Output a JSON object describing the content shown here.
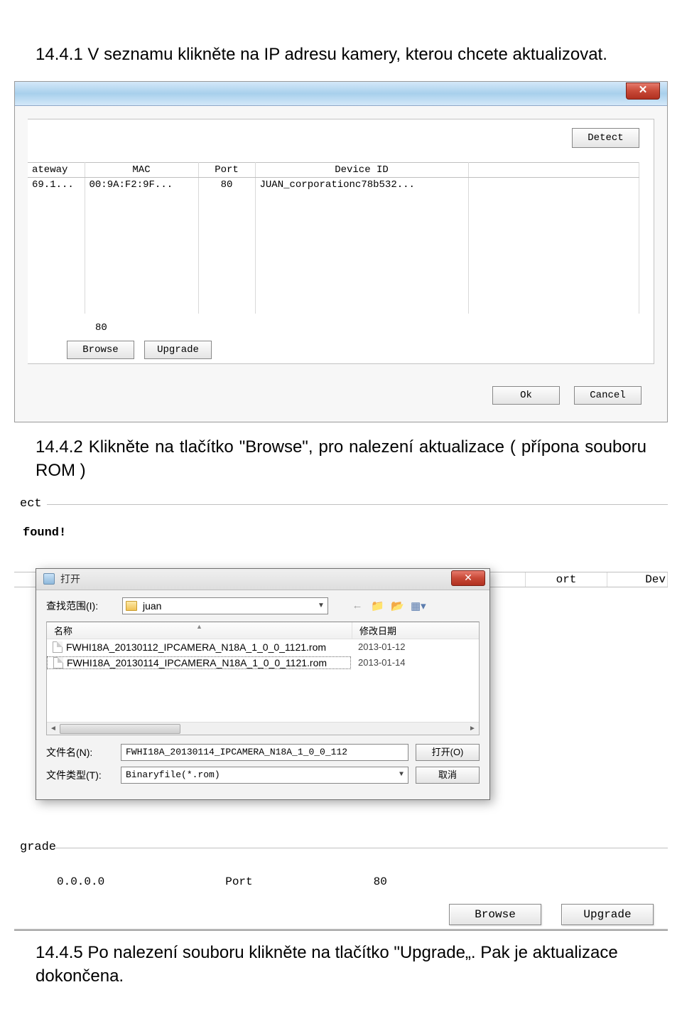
{
  "text": {
    "step1": "14.4.1 V seznamu klikněte na IP adresu kamery, kterou chcete aktualizovat.",
    "step2": "14.4.2 Klikněte na tlačítko \"Browse\", pro nalezení aktualizace ( přípona souboru ROM )",
    "step3": "14.4.5 Po nalezení souboru klikněte na tlačítko \"Upgrade„. Pak je aktualizace dokončena."
  },
  "dialog1": {
    "detect": "Detect",
    "headers": {
      "gw": "ateway",
      "mac": "MAC",
      "port": "Port",
      "devid": "Device ID"
    },
    "row": {
      "gw": "69.1...",
      "mac": "00:9A:F2:9F...",
      "port": "80",
      "devid": "JUAN_corporationc78b532..."
    },
    "port_value": "80",
    "browse": "Browse",
    "upgrade": "Upgrade",
    "ok": "Ok",
    "cancel": "Cancel"
  },
  "dialog2": {
    "ect": "ect",
    "found": "found!",
    "bg_port": "ort",
    "bg_dev": "Dev",
    "open_title": "打开",
    "look_in": "查找范围(I):",
    "folder": "juan",
    "col_name": "名称",
    "col_date": "修改日期",
    "files": [
      {
        "name": "FWHI18A_20130112_IPCAMERA_N18A_1_0_0_1121.rom",
        "date": "2013-01-12"
      },
      {
        "name": "FWHI18A_20130114_IPCAMERA_N18A_1_0_0_1121.rom",
        "date": "2013-01-14"
      }
    ],
    "filename_label": "文件名(N):",
    "filename_value": "FWHI18A_20130114_IPCAMERA_N18A_1_0_0_112",
    "filetype_label": "文件类型(T):",
    "filetype_value": "Binaryfile(*.rom)",
    "open_btn": "打开(O)",
    "cancel_btn": "取消",
    "grade": "grade",
    "ip": "0.0.0.0",
    "port_label": "Port",
    "port_value": "80",
    "browse": "Browse",
    "upgrade": "Upgrade"
  }
}
